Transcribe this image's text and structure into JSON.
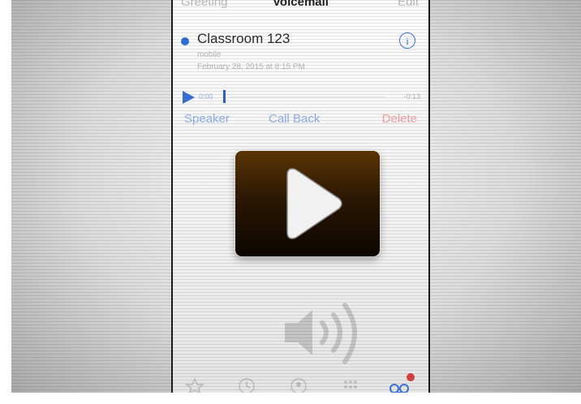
{
  "navbar": {
    "left": "Greeting",
    "title": "Voicemail",
    "right": "Edit"
  },
  "voicemail": {
    "caller": "Classroom 123",
    "label": "mobile",
    "date": "February 28, 2015 at 8:15 PM",
    "elapsed": "0:00",
    "remaining": "-0:13",
    "info_icon": "info-icon",
    "unread_color": "#2f6fd6"
  },
  "actions": {
    "speaker": "Speaker",
    "call_back": "Call Back",
    "delete": "Delete"
  },
  "colors": {
    "accent": "#3a74d8",
    "delete": "#e05454",
    "overlay_top": "#5a3504",
    "overlay_bottom": "#0c0601"
  },
  "icons": {
    "overlay": "play-icon",
    "center": "speaker-volume-icon",
    "tabs": [
      "favorites-icon",
      "recents-icon",
      "contacts-icon",
      "keypad-icon",
      "voicemail-icon"
    ]
  }
}
